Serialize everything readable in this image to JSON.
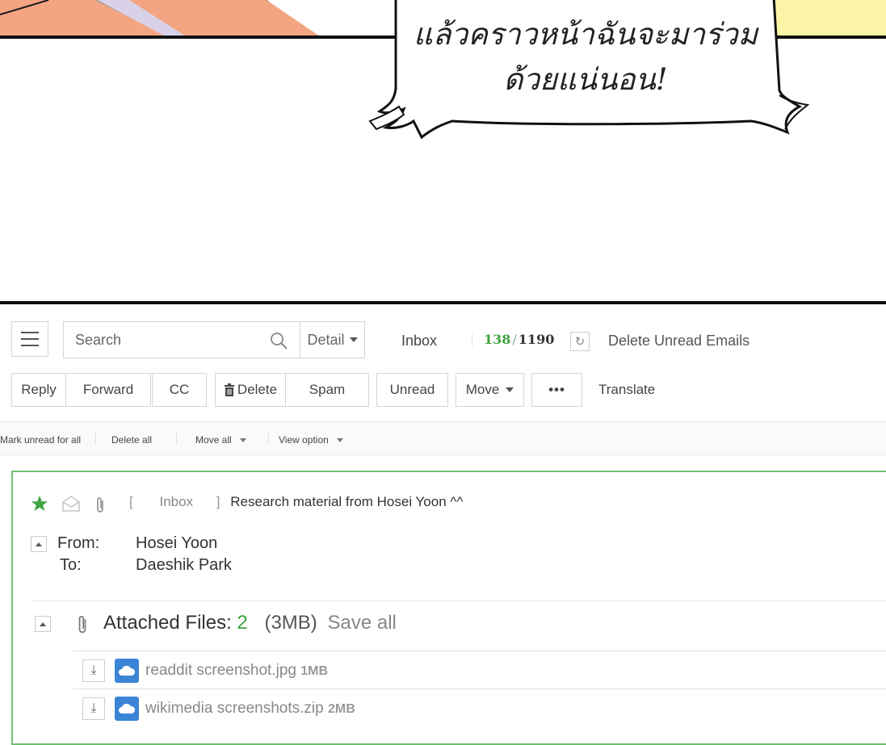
{
  "comic": {
    "speech_line1": "แล้วคราวหน้าฉันจะมาร่วม",
    "speech_line2": "ด้วยแน่นอน!"
  },
  "toolbar_top": {
    "search_placeholder": "Search",
    "detail_label": "Detail",
    "folder_label": "Inbox",
    "unread_count": "138",
    "separator": "/",
    "total_count": "1190",
    "delete_unread_label": "Delete Unread Emails"
  },
  "actions": {
    "reply": "Reply",
    "forward": "Forward",
    "cc": "CC",
    "delete": "Delete",
    "spam": "Spam",
    "unread": "Unread",
    "move": "Move",
    "more": "•••",
    "translate": "Translate"
  },
  "subbar": {
    "mark_unread_all": "Mark unread for all",
    "delete_all": "Delete all",
    "move_all": "Move all",
    "view_option": "View option"
  },
  "message": {
    "open_bracket": "[",
    "folder": "Inbox",
    "close_bracket": "]",
    "subject": "Research material from Hosei Yoon ^^",
    "from_label": "From:",
    "from_value": "Hosei Yoon",
    "to_label": "To:",
    "to_value": "Daeshik Park",
    "attachments_label": "Attached Files:",
    "attachments_count": "2",
    "attachments_size": "(3MB)",
    "save_all": "Save all",
    "files": [
      {
        "name": "readdit screenshot.jpg",
        "size": "1MB"
      },
      {
        "name": "wikimedia screenshots.zip",
        "size": "2MB"
      }
    ]
  },
  "colors": {
    "accent_green": "#3fa33f",
    "card_border": "#6fc06f",
    "cloud_blue": "#3b84d6"
  },
  "icons": [
    "menu-icon",
    "search-icon",
    "refresh-icon",
    "trash-icon",
    "star-icon",
    "envelope-icon",
    "paperclip-icon",
    "download-icon",
    "cloud-icon"
  ]
}
